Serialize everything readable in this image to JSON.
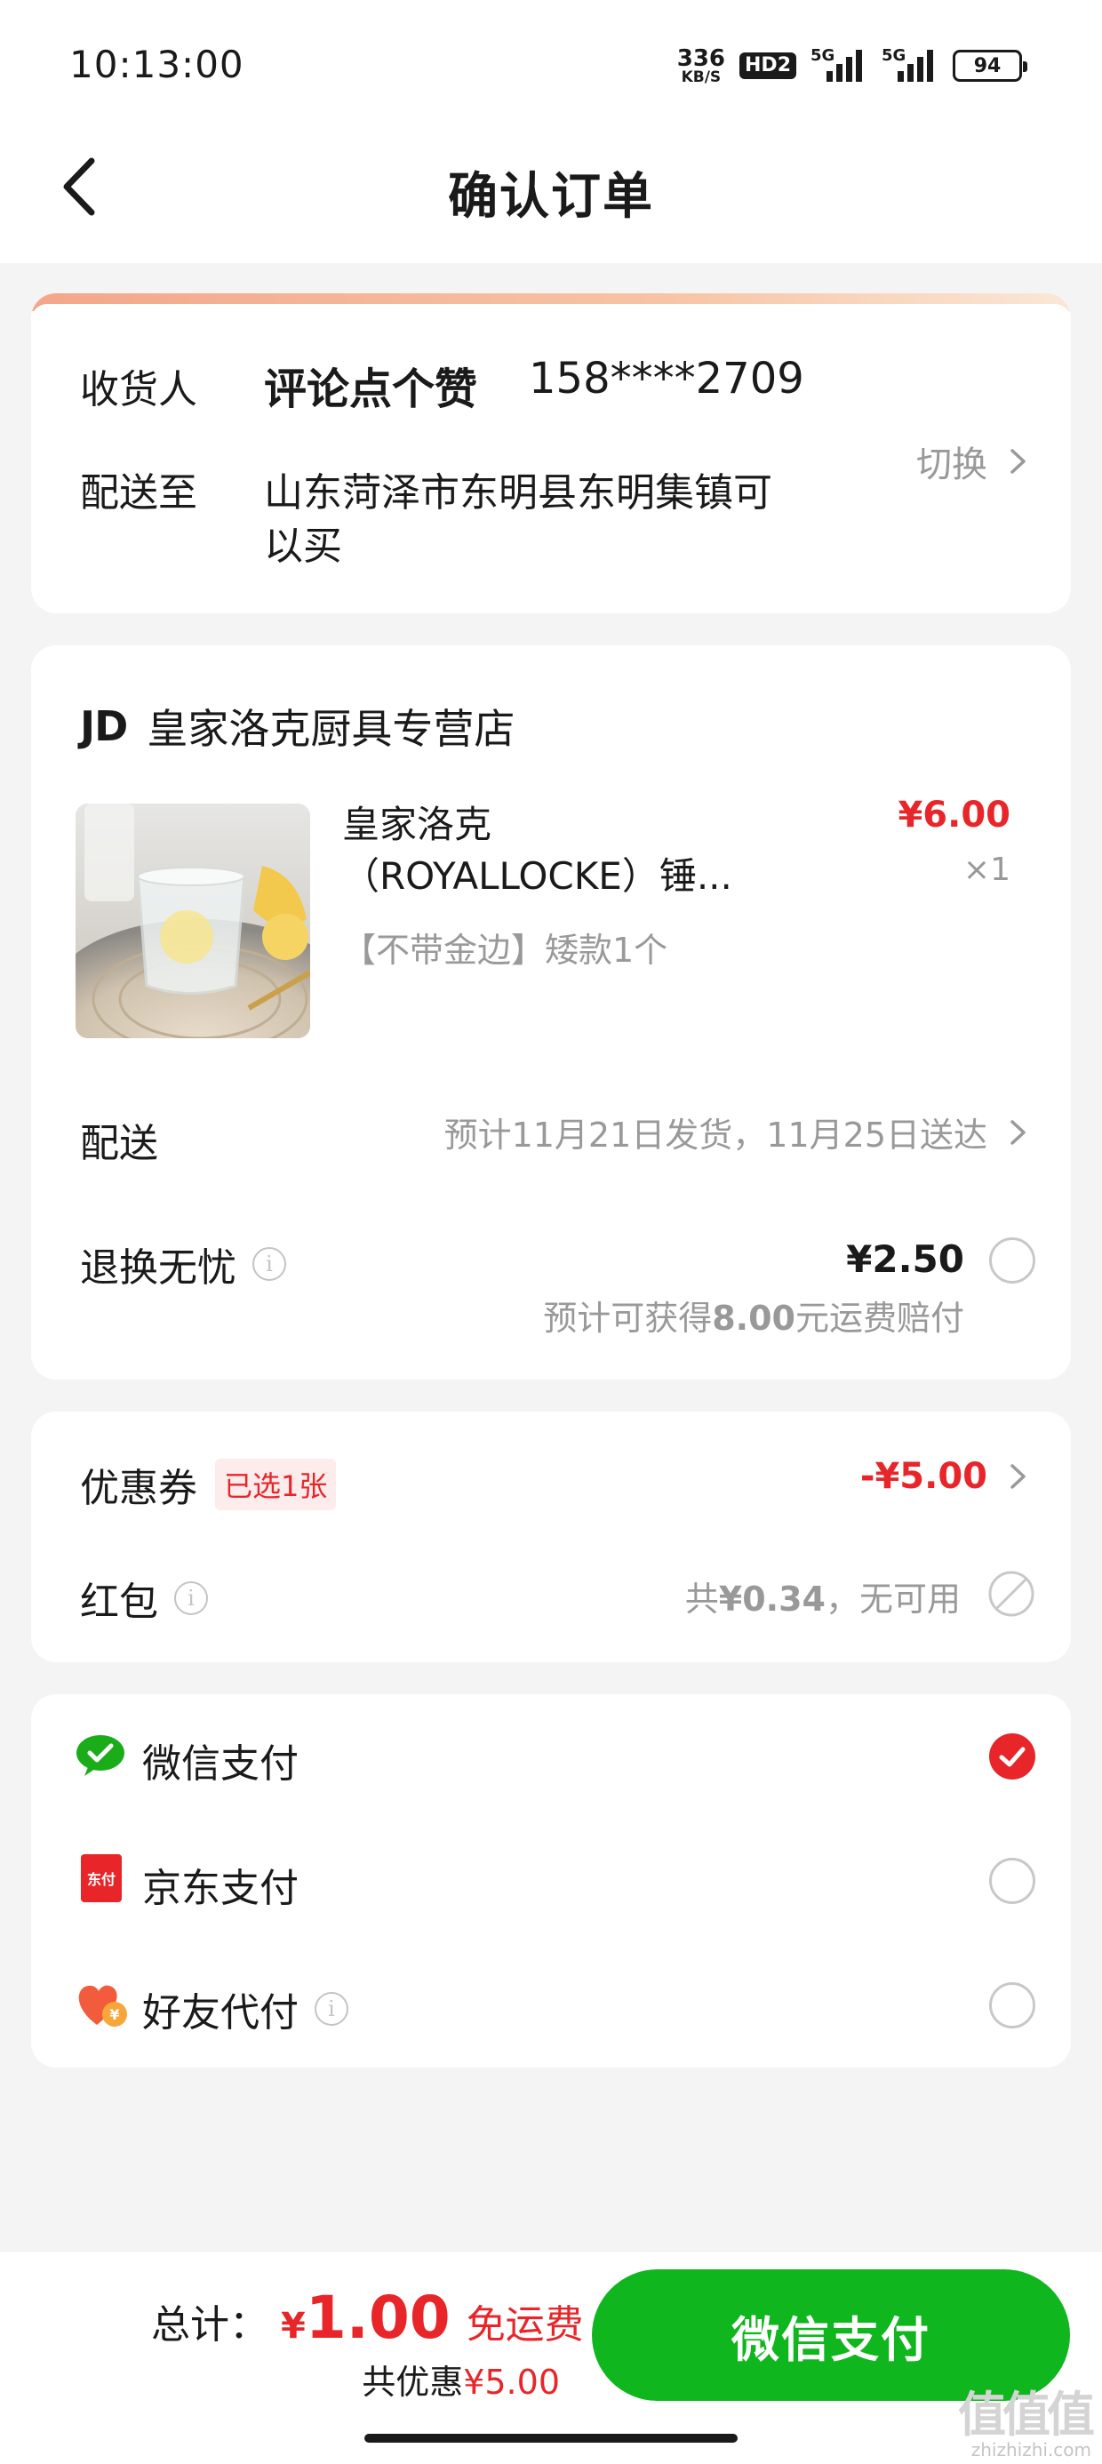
{
  "status_bar": {
    "time": "10:13:00",
    "net_speed_value": "336",
    "net_speed_unit": "KB/S",
    "hd_label": "HD2",
    "signal1_label": "5G",
    "signal2_label": "5G",
    "battery": "94"
  },
  "header": {
    "title": "确认订单"
  },
  "address": {
    "recipient_label": "收货人",
    "recipient_name": "评论点个赞",
    "recipient_phone": "158****2709",
    "deliver_label": "配送至",
    "address_line1": "山东菏泽市东明县东明集镇可",
    "address_line2": "以买",
    "switch_label": "切换"
  },
  "store": {
    "logo_text": "JD",
    "name": "皇家洛克厨具专营店"
  },
  "product": {
    "title_line1": "皇家洛克",
    "title_line2": "（ROYALLOCKE）锤...",
    "spec": "【不带金边】矮款1个",
    "price": "¥6.00",
    "quantity": "×1"
  },
  "delivery": {
    "label": "配送",
    "value": "预计11月21日发货，11月25日送达"
  },
  "return_service": {
    "label": "退换无忧",
    "price": "¥2.50",
    "note_prefix": "预计可获得",
    "note_amount": "8.00",
    "note_suffix": "元运费赔付"
  },
  "coupon": {
    "label": "优惠券",
    "badge": "已选1张",
    "value": "-¥5.00"
  },
  "red_packet": {
    "label": "红包",
    "prefix": "共",
    "amount": "¥0.34",
    "suffix": "，无可用"
  },
  "payment_methods": [
    {
      "label": "微信支付",
      "icon": "wechat-pay-icon",
      "selected": true
    },
    {
      "label": "京东支付",
      "icon": "jd-pay-icon",
      "selected": false
    },
    {
      "label": "好友代付",
      "icon": "friend-pay-icon",
      "selected": false
    }
  ],
  "jd_pay_icon_text": "东付",
  "bottom": {
    "total_label": "总计：",
    "total_currency": "¥",
    "total_amount": "1.00",
    "free_shipping": "免运费",
    "discount_prefix": "共优惠",
    "discount_amount": "¥5.00",
    "pay_button": "微信支付"
  },
  "watermark": {
    "logo": "值值值",
    "site": "zhizhizhi.com"
  },
  "colors": {
    "accent_red": "#e8262a",
    "wechat_green": "#0fb61e",
    "background": "#f4f4f4"
  }
}
